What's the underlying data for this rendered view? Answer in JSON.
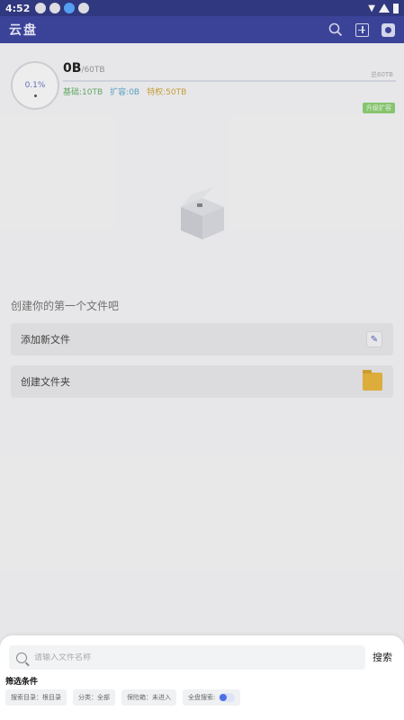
{
  "status_bar": {
    "time": "4:52"
  },
  "app_bar": {
    "title": "云盘"
  },
  "usage": {
    "percent": "0.1%",
    "used": "0B",
    "total": "/60TB",
    "corner_label": "总60TB",
    "base": "基础:10TB",
    "expand": "扩容:0B",
    "privilege": "特权:50TB",
    "badge": "升级扩容"
  },
  "empty_state": {
    "hint": "创建你的第一个文件吧",
    "add_file": "添加新文件",
    "create_folder": "创建文件夹"
  },
  "search_sheet": {
    "placeholder": "请输入文件名称",
    "search_button": "搜索",
    "filter_title": "筛选条件",
    "chips": [
      "搜索目录：根目录",
      "分类：全部",
      "保险箱：未进入",
      "全盘搜索:"
    ],
    "global_search_on": true
  },
  "colors": {
    "app_bar": "#3e47a1",
    "status_bar": "#333b86",
    "accent": "#4d70e6",
    "folder": "#e8b73f"
  }
}
